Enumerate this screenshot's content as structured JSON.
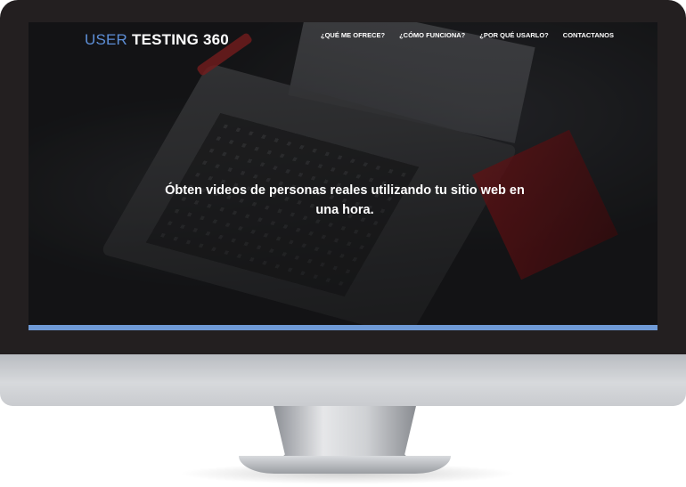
{
  "logo": {
    "accent": "USER",
    "rest": "TESTING 360"
  },
  "nav": {
    "items": [
      {
        "label": "¿QUÉ ME OFRECE?"
      },
      {
        "label": "¿CÓMO FUNCIONA?"
      },
      {
        "label": "¿POR QUÉ USARLO?"
      },
      {
        "label": "CONTACTANOS"
      }
    ]
  },
  "hero": {
    "headline": "Óbten videos de personas reales utilizando tu sitio web en una hora."
  },
  "colors": {
    "brand_accent": "#5d8ed6",
    "accent_bar": "#6f9ad6",
    "bezel": "#231f20"
  }
}
